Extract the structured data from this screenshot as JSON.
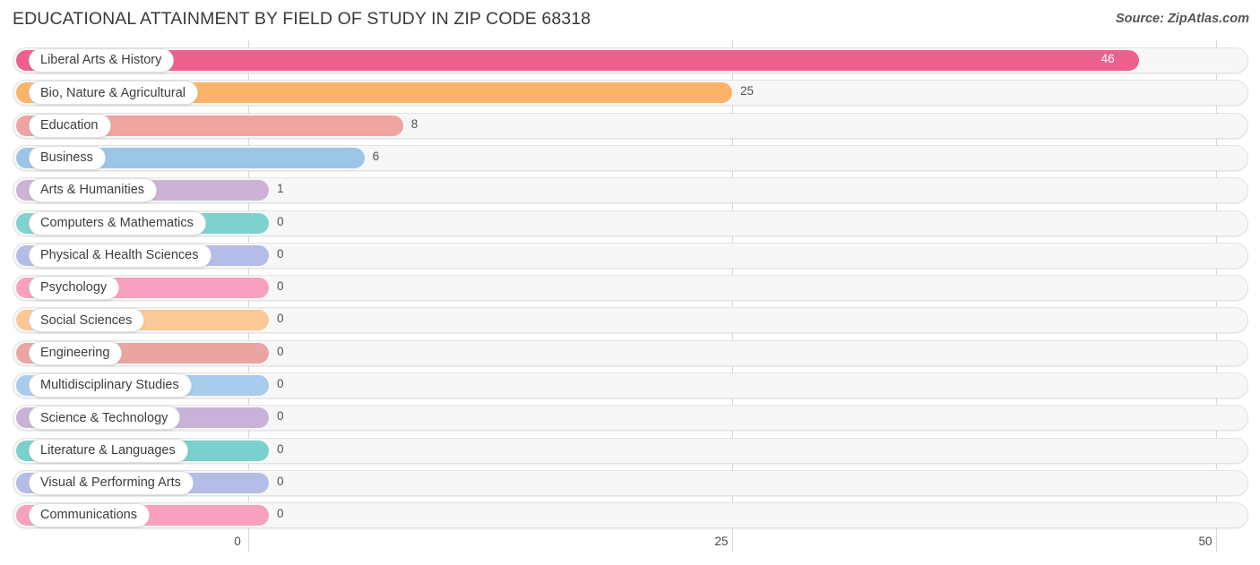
{
  "header": {
    "title": "EDUCATIONAL ATTAINMENT BY FIELD OF STUDY IN ZIP CODE 68318",
    "source": "Source: ZipAtlas.com"
  },
  "chart_data": {
    "type": "bar",
    "orientation": "horizontal",
    "title": "EDUCATIONAL ATTAINMENT BY FIELD OF STUDY IN ZIP CODE 68318",
    "xlabel": "",
    "ylabel": "",
    "xlim": [
      0,
      50
    ],
    "xticks": [
      0,
      25,
      50
    ],
    "xtick_labels": [
      "0",
      "25",
      "50"
    ],
    "grid": true,
    "legend": false,
    "categories": [
      "Liberal Arts & History",
      "Bio, Nature & Agricultural",
      "Education",
      "Business",
      "Arts & Humanities",
      "Computers & Mathematics",
      "Physical & Health Sciences",
      "Psychology",
      "Social Sciences",
      "Engineering",
      "Multidisciplinary Studies",
      "Science & Technology",
      "Literature & Languages",
      "Visual & Performing Arts",
      "Communications"
    ],
    "values": [
      46,
      25,
      8,
      6,
      1,
      0,
      0,
      0,
      0,
      0,
      0,
      0,
      0,
      0,
      0
    ],
    "value_labels": [
      "46",
      "25",
      "8",
      "6",
      "1",
      "0",
      "0",
      "0",
      "0",
      "0",
      "0",
      "0",
      "0",
      "0",
      "0"
    ],
    "colors": [
      "#ef5f8d",
      "#fbb36a",
      "#efa49f",
      "#9cc5e8",
      "#cbb2d6",
      "#7ed3cf",
      "#b4bce8",
      "#f9a0c1",
      "#fcc893",
      "#eaa5a3",
      "#a8cced",
      "#c9b2d7",
      "#79d0cc",
      "#b4bce8",
      "#f99fc0"
    ]
  },
  "axis": {
    "ticks": [
      {
        "label": "0",
        "value": 0
      },
      {
        "label": "25",
        "value": 25
      },
      {
        "label": "50",
        "value": 50
      }
    ]
  }
}
